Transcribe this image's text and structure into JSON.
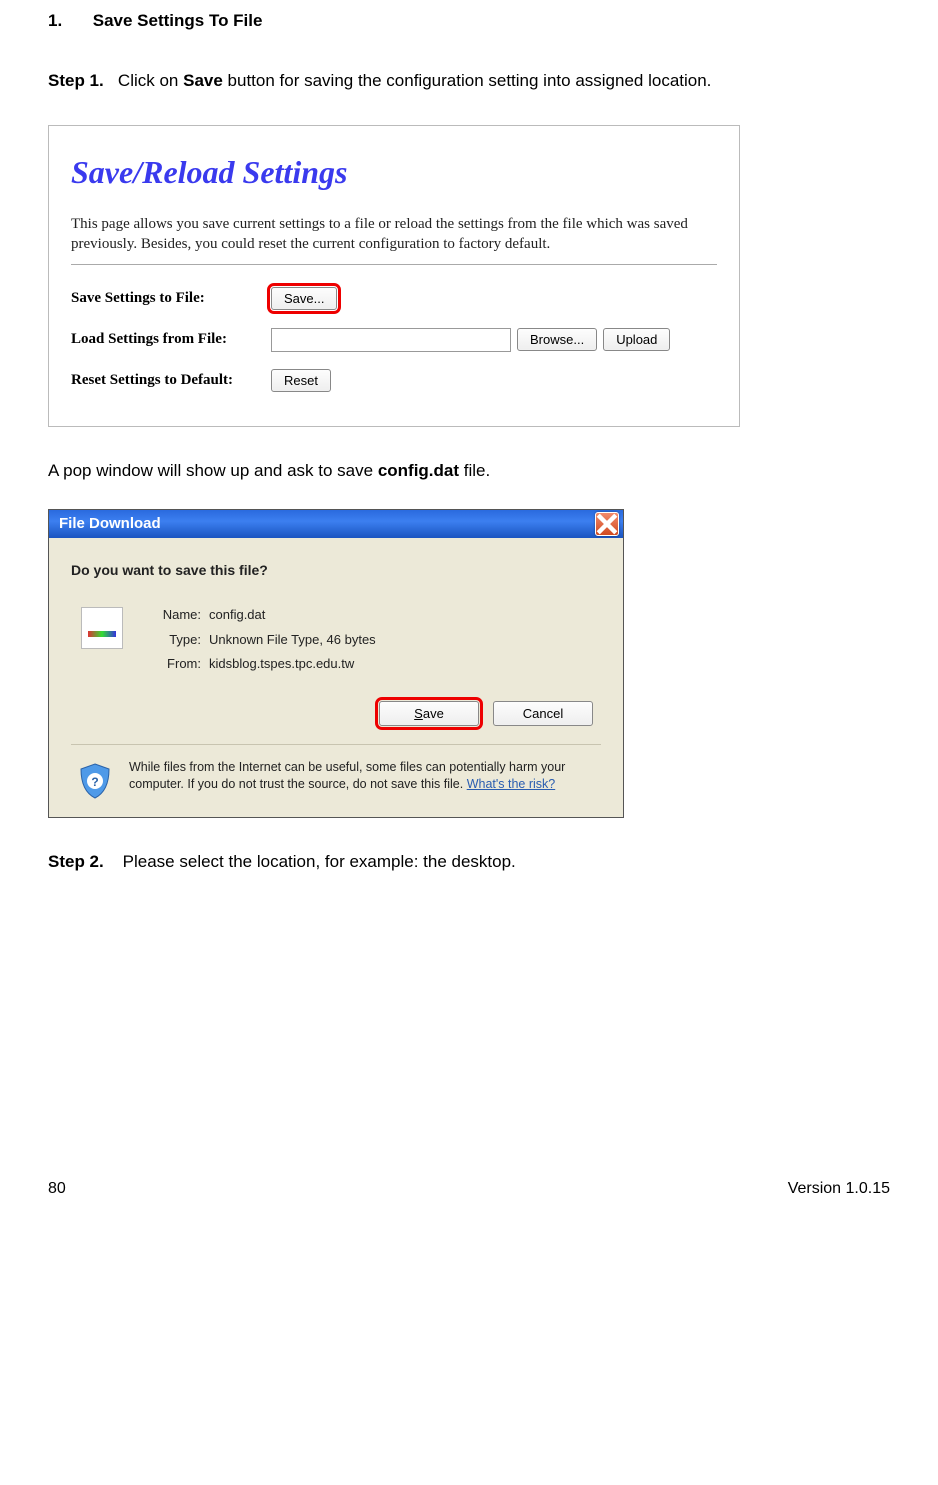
{
  "section": {
    "number": "1.",
    "title": "Save Settings To File"
  },
  "step1": {
    "label": "Step 1.",
    "prefix": "Click on ",
    "bold1": "Save",
    "rest": " button for saving the configuration setting into assigned location."
  },
  "s1": {
    "heading": "Save/Reload Settings",
    "desc": "This page allows you save current settings to a file or reload the settings from the file which was saved previously. Besides, you could reset the current configuration to factory default.",
    "row1": {
      "label": "Save Settings to File:",
      "btn": "Save..."
    },
    "row2": {
      "label": "Load Settings from File:",
      "browse": "Browse...",
      "upload": "Upload"
    },
    "row3": {
      "label": "Reset Settings to Default:",
      "btn": "Reset"
    }
  },
  "mid": {
    "prefix": "A pop window will show up and ask to save ",
    "bold": "config.dat",
    "suffix": " file."
  },
  "s2": {
    "title": "File Download",
    "question": "Do you want to save this file?",
    "name_k": "Name:",
    "name_v": "config.dat",
    "type_k": "Type:",
    "type_v": "Unknown File Type, 46 bytes",
    "from_k": "From:",
    "from_v": "kidsblog.tspes.tpc.edu.tw",
    "save_btn": "ave",
    "save_u": "S",
    "cancel_btn": "Cancel",
    "warn": "While files from the Internet can be useful, some files can potentially harm your computer. If you do not trust the source, do not save this file. ",
    "link": "What's the risk?"
  },
  "step2": {
    "label": "Step 2.",
    "text": "Please select the location, for example: the desktop."
  },
  "footer": {
    "page": "80",
    "version": "Version 1.0.15"
  }
}
